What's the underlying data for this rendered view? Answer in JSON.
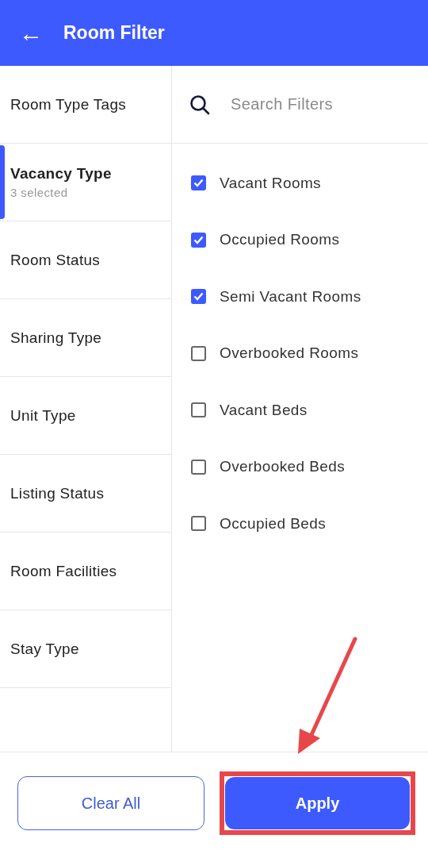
{
  "header": {
    "back": "←",
    "title": "Room Filter"
  },
  "sidebar": {
    "items": [
      {
        "label": "Room Type Tags",
        "selected": false
      },
      {
        "label": "Vacancy Type",
        "sublabel": "3 selected",
        "selected": true
      },
      {
        "label": "Room Status",
        "selected": false
      },
      {
        "label": "Sharing Type",
        "selected": false
      },
      {
        "label": "Unit Type",
        "selected": false
      },
      {
        "label": "Listing Status",
        "selected": false
      },
      {
        "label": "Room Facilities",
        "selected": false
      },
      {
        "label": "Stay Type",
        "selected": false
      }
    ]
  },
  "search": {
    "placeholder": "Search Filters"
  },
  "options": [
    {
      "label": "Vacant Rooms",
      "checked": true
    },
    {
      "label": "Occupied Rooms",
      "checked": true
    },
    {
      "label": "Semi Vacant Rooms",
      "checked": true
    },
    {
      "label": "Overbooked Rooms",
      "checked": false
    },
    {
      "label": "Vacant Beds",
      "checked": false
    },
    {
      "label": "Overbooked Beds",
      "checked": false
    },
    {
      "label": "Occupied Beds",
      "checked": false
    }
  ],
  "buttons": [
    {
      "label": "Clear All",
      "kind": "secondary"
    },
    {
      "label": "Apply",
      "kind": "primary",
      "highlighted": true
    }
  ]
}
